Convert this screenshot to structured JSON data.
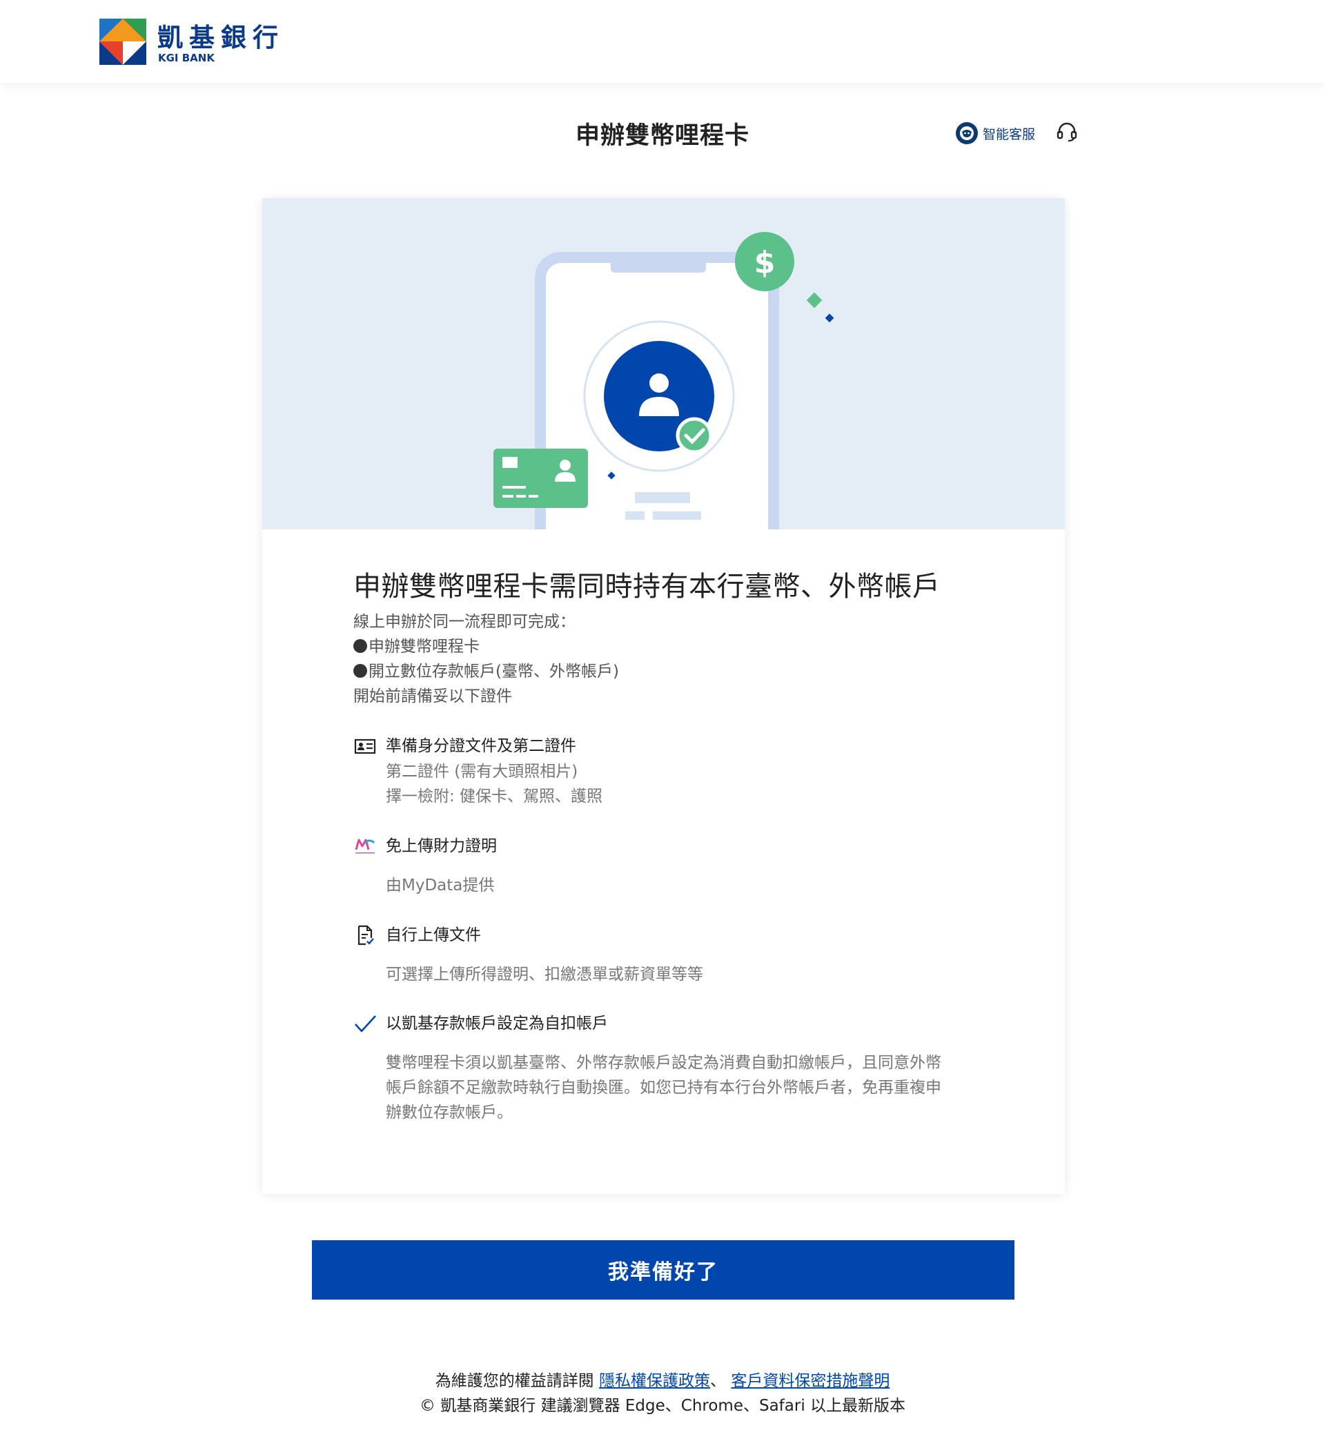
{
  "header": {
    "brand_zh": "凱基銀行",
    "brand_en": "KGI BANK"
  },
  "page": {
    "title": "申辦雙幣哩程卡",
    "customer_service_label": "智能客服"
  },
  "card": {
    "headline": "申辦雙幣哩程卡需同時持有本行臺幣、外幣帳戶",
    "intro": {
      "line1": "線上申辦於同一流程即可完成：",
      "bullet1": "申辦雙幣哩程卡",
      "bullet2": "開立數位存款帳戶(臺幣、外幣帳戶)",
      "line4": "開始前請備妥以下證件"
    },
    "items": [
      {
        "icon": "id-card-icon",
        "title": "準備身分證文件及第二證件",
        "lines": [
          "第二證件 (需有大頭照相片)",
          "擇一檢附: 健保卡、駕照、護照"
        ]
      },
      {
        "icon": "mydata-icon",
        "title": "免上傳財力證明",
        "lines": [
          "由MyData提供"
        ]
      },
      {
        "icon": "document-upload-icon",
        "title": "自行上傳文件",
        "lines": [
          "可選擇上傳所得證明、扣繳憑單或薪資單等等"
        ]
      },
      {
        "icon": "checkmark-icon",
        "title": "以凱基存款帳戶設定為自扣帳戶",
        "lines": [
          "雙幣哩程卡須以凱基臺幣、外幣存款帳戶設定為消費自動扣繳帳戶，且同意外幣",
          "帳戶餘額不足繳款時執行自動換匯。如您已持有本行台外幣帳戶者，免再重複申",
          "辦數位存款帳戶。"
        ]
      }
    ]
  },
  "cta": {
    "label": "我準備好了"
  },
  "footer": {
    "prefix": "為維護您的權益請詳閱 ",
    "privacy_link": "隱私權保護政策",
    "separator": "、 ",
    "security_link": "客戶資料保密措施聲明",
    "copyright": "© 凱基商業銀行 建議瀏覽器 Edge、Chrome、Safari 以上最新版本"
  },
  "colors": {
    "brand_blue": "#0046ad",
    "hero_bg": "#e4edf6",
    "accent_green": "#5cc08b"
  }
}
